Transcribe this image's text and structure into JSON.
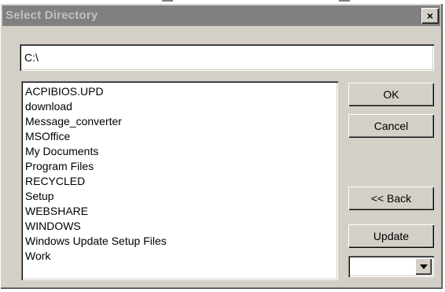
{
  "window": {
    "title": "Select Directory",
    "close_label": "×"
  },
  "path_field": {
    "value": "C:\\"
  },
  "directory_list": {
    "items": [
      "ACPIBIOS.UPD",
      "download",
      "Message_converter",
      "MSOffice",
      "My Documents",
      "Program Files",
      "RECYCLED",
      "Setup",
      "WEBSHARE",
      "WINDOWS",
      "Windows Update Setup Files",
      "Work"
    ]
  },
  "buttons": {
    "ok": "OK",
    "cancel": "Cancel",
    "back": "<< Back",
    "update": "Update"
  },
  "drive_select": {
    "value": ""
  },
  "colors": {
    "dialog_face": "#d4d0c8",
    "titlebar_inactive": "#808080",
    "title_text": "#c0c0c0"
  }
}
